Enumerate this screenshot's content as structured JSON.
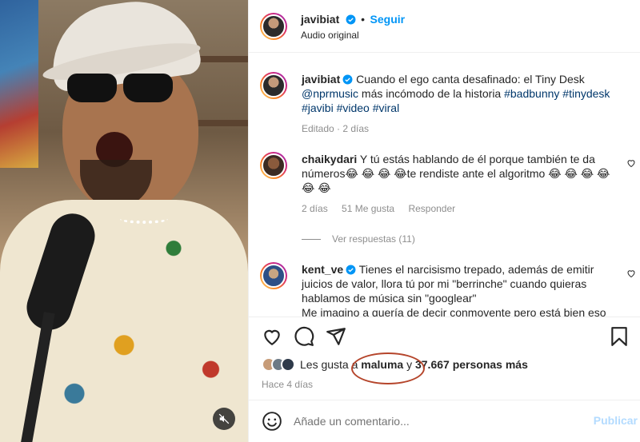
{
  "header": {
    "username": "javibiat",
    "follow_label": "Seguir",
    "separator": "•",
    "audio_label": "Audio original"
  },
  "caption": {
    "username": "javibiat",
    "text_line1": "Cuando el ego canta desafinado: el Tiny Desk",
    "mention": "@nprmusic",
    "text_line2": "más incómodo de la historia",
    "tags_line2": "#badbunny #tinydesk",
    "tags_line3": "#javibi #video #viral",
    "meta": "Editado · 2 días"
  },
  "comments": [
    {
      "username": "chaikydari",
      "text_line1": "Y tú estás hablando de él porque también te da",
      "text_line2": "números😂 😂 😂 😂te rendiste ante el algoritmo 😂 😂 😂 😂",
      "text_line3": "😂 😂",
      "time": "2 días",
      "likes": "51 Me gusta",
      "reply_label": "Responder",
      "view_replies": "Ver respuestas (11)"
    },
    {
      "username": "kent_ve",
      "text_line1": "Tienes el narcisismo trepado, además de emitir",
      "text_line2": "juicios de valor, llora tú por mi \"berrinche\" cuando quieras",
      "text_line3": "hablamos de música sin \"googlear\"",
      "text_line4": "Me imagino a quería de decir conmovente pero está bien eso"
    }
  ],
  "likes": {
    "prefix": "Les gusta a",
    "name": "maluma",
    "connector": "y",
    "count_text": "37.667 personas más"
  },
  "posted": "Hace 4 días",
  "add_comment": {
    "placeholder": "Añade un comentario...",
    "publish_label": "Publicar"
  },
  "colors": {
    "accent": "#0095f6",
    "highlight_oval": "#b5452b",
    "hashtag": "#00376b"
  },
  "icons": [
    "verified-badge-icon",
    "heart-icon",
    "comment-icon",
    "share-icon",
    "bookmark-icon",
    "emoji-icon",
    "mute-icon"
  ]
}
